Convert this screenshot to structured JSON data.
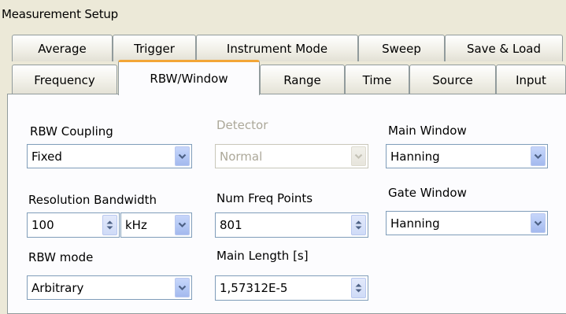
{
  "title": "Measurement Setup",
  "tabs_row1": [
    {
      "label": "Average"
    },
    {
      "label": "Trigger"
    },
    {
      "label": "Instrument Mode"
    },
    {
      "label": "Sweep"
    },
    {
      "label": "Save & Load"
    }
  ],
  "tabs_row2": [
    {
      "label": "Frequency"
    },
    {
      "label": "RBW/Window"
    },
    {
      "label": "Range"
    },
    {
      "label": "Time"
    },
    {
      "label": "Source"
    },
    {
      "label": "Input"
    }
  ],
  "active_tab": "RBW/Window",
  "accent_color": "#f3a637",
  "fields": {
    "rbw_coupling": {
      "label": "RBW Coupling",
      "value": "Fixed"
    },
    "detector": {
      "label": "Detector",
      "value": "Normal",
      "disabled": true
    },
    "main_window": {
      "label": "Main Window",
      "value": "Hanning"
    },
    "resolution_bandwidth": {
      "label": "Resolution Bandwidth",
      "value": "100",
      "unit": "kHz"
    },
    "num_freq_points": {
      "label": "Num Freq Points",
      "value": "801"
    },
    "gate_window": {
      "label": "Gate Window",
      "value": "Hanning"
    },
    "rbw_mode": {
      "label": "RBW mode",
      "value": "Arbitrary"
    },
    "main_length": {
      "label": "Main Length [s]",
      "value": "1,57312E-5"
    }
  },
  "icons": {
    "dropdown": "chevron-down-icon",
    "spinner": "spin-arrows-icon"
  }
}
